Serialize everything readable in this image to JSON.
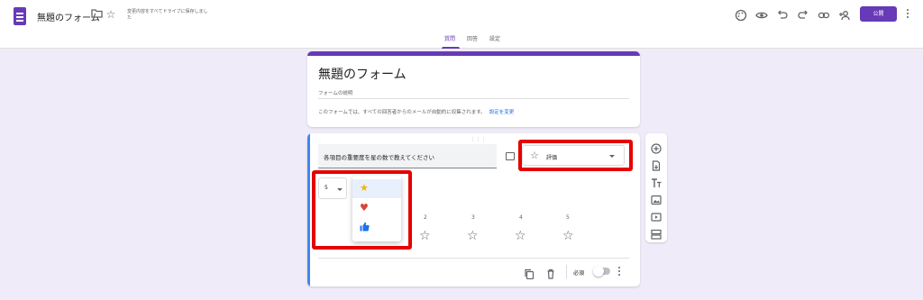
{
  "header": {
    "doc_title": "無題のフォーム",
    "save_status": "変更内容をすべてドライブに保存しました",
    "publish_label": "公開"
  },
  "tabs": [
    {
      "label": "質問",
      "active": true
    },
    {
      "label": "回答",
      "active": false
    },
    {
      "label": "設定",
      "active": false
    }
  ],
  "form": {
    "title": "無題のフォーム",
    "description_placeholder": "フォームの説明",
    "collect_note": "このフォームでは、すべての回答者からのメールが自動的に収集されます。",
    "collect_link": "設定を変更"
  },
  "question": {
    "text": "各項目の重要度を星の数で教えてください",
    "type_label": "評価",
    "scale_value": "5",
    "icon_options": [
      "star-icon",
      "heart-icon",
      "thumbs-up-icon"
    ],
    "scale_numbers": [
      "2",
      "3",
      "4",
      "5"
    ],
    "required_label": "必須"
  },
  "colors": {
    "accent": "#673ab7",
    "question_bar": "#4285f4",
    "highlight": "#e60000",
    "star_option": "#f4b400",
    "heart_option": "#db4437",
    "thumb_option": "#1a73e8"
  }
}
